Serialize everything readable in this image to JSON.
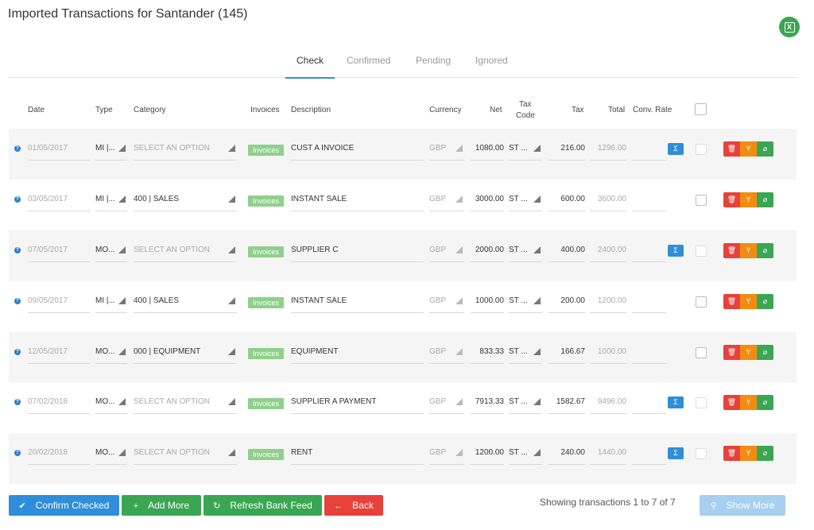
{
  "page": {
    "title": "Imported Transactions for Santander (145)",
    "excel_icon": "excel-icon"
  },
  "tabs": [
    {
      "label": "Check"
    },
    {
      "label": "Confirmed"
    },
    {
      "label": "Pending"
    },
    {
      "label": "Ignored"
    }
  ],
  "columns": {
    "date": "Date",
    "type": "Type",
    "category": "Category",
    "invoices": "Invoices",
    "description": "Description",
    "currency": "Currency",
    "net": "Net",
    "tax_code_1": "Tax",
    "tax_code_2": "Code",
    "tax": "Tax",
    "total": "Total",
    "conv_rate": "Conv. Rate"
  },
  "rows": [
    {
      "date": "01/05/2017",
      "type": "MI |...",
      "category": "SELECT AN OPTION",
      "invoices": "Invoices",
      "description": "CUST A INVOICE",
      "currency": "GBP",
      "net": "1080.00",
      "tax_code": "ST ...",
      "tax": "216.00",
      "total": "1296.00",
      "sigma": "Σ"
    },
    {
      "date": "03/05/2017",
      "type": "MI |...",
      "category": "400 | SALES",
      "invoices": "Invoices",
      "description": "INSTANT SALE",
      "currency": "GBP",
      "net": "3000.00",
      "tax_code": "ST ...",
      "tax": "600.00",
      "total": "3600.00"
    },
    {
      "date": "07/05/2017",
      "type": "MO...",
      "category": "SELECT AN OPTION",
      "invoices": "Invoices",
      "description": "SUPPLIER C",
      "currency": "GBP",
      "net": "2000.00",
      "tax_code": "ST ...",
      "tax": "400.00",
      "total": "2400.00",
      "sigma": "Σ"
    },
    {
      "date": "09/05/2017",
      "type": "MI |...",
      "category": "400 | SALES",
      "invoices": "Invoices",
      "description": "INSTANT SALE",
      "currency": "GBP",
      "net": "1000.00",
      "tax_code": "ST ...",
      "tax": "200.00",
      "total": "1200.00"
    },
    {
      "date": "12/05/2017",
      "type": "MO...",
      "category": "000 | EQUIPMENT",
      "invoices": "Invoices",
      "description": "EQUIPMENT",
      "currency": "GBP",
      "net": "833.33",
      "tax_code": "ST ...",
      "tax": "166.67",
      "total": "1000.00"
    },
    {
      "date": "07/02/2018",
      "type": "MO...",
      "category": "SELECT AN OPTION",
      "invoices": "Invoices",
      "description": "SUPPLIER A PAYMENT",
      "currency": "GBP",
      "net": "7913.33",
      "tax_code": "ST ...",
      "tax": "1582.67",
      "total": "9496.00",
      "sigma": "Σ"
    },
    {
      "date": "20/02/2018",
      "type": "MO...",
      "category": "SELECT AN OPTION",
      "invoices": "Invoices",
      "description": "RENT",
      "currency": "GBP",
      "net": "1200.00",
      "tax_code": "ST ...",
      "tax": "240.00",
      "total": "1440.00",
      "sigma": "Σ"
    }
  ],
  "icons": {
    "help": "?",
    "delete": "trash-icon",
    "split": "split-icon",
    "attach": "paperclip-icon"
  },
  "buttons": {
    "confirm": "Confirm Checked",
    "add": "Add More",
    "refresh": "Refresh Bank Feed",
    "back": "Back",
    "show_more": "Show More"
  },
  "footer": {
    "status": "Showing transactions 1 to 7 of 7"
  },
  "colors": {
    "primary": "#2e8ed9",
    "success": "#3aa653",
    "danger": "#e8403a",
    "warning": "#f28c0f",
    "disabled": "#a7cff0"
  }
}
